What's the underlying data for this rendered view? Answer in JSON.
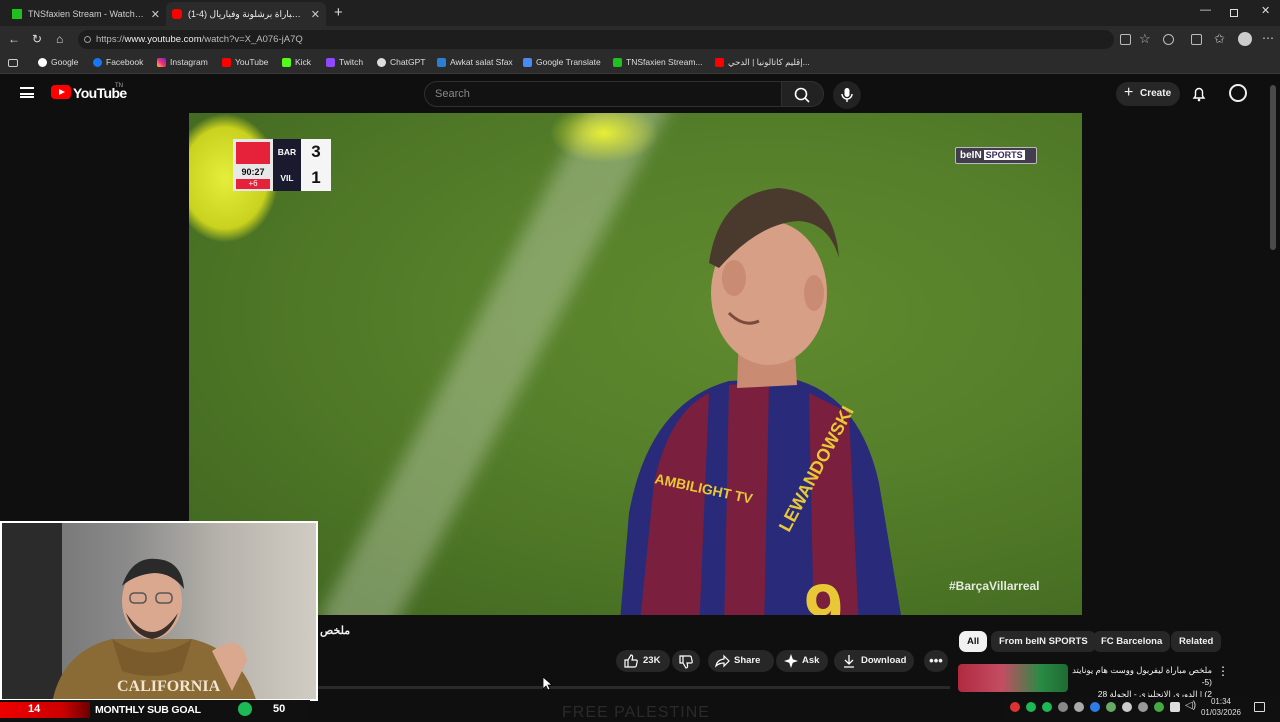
{
  "browser": {
    "tabs": [
      {
        "title": "TNSfaxien Stream - Watch Live on",
        "active": false
      },
      {
        "title": "ملخص مباراة برشلونة وفياريال (4-1)",
        "active": true
      }
    ],
    "url_prefix": "https://",
    "url_domain": "www.youtube.com",
    "url_path": "/watch?v=X_A076-jA7Q",
    "bookmarks": [
      "Google",
      "Facebook",
      "Instagram",
      "YouTube",
      "Kick",
      "Twitch",
      "ChatGPT",
      "Awkat salat Sfax",
      "Google Translate",
      "TNSfaxien Stream...",
      "إقليم كاتالونيا | الدحي..."
    ]
  },
  "youtube": {
    "logo_text": "YouTube",
    "logo_country": "TN",
    "search_placeholder": "Search",
    "create_label": "Create"
  },
  "video": {
    "scoreboard": {
      "home_team": "BAR",
      "away_team": "VIL",
      "home_score": "3",
      "away_score": "1",
      "clock": "90:27",
      "added_time": "+6"
    },
    "broadcaster_a": "beIN",
    "broadcaster_b": "SPORTS",
    "hashtag": "#BarçaVillarreal",
    "jersey_name": "LEWANDOWSKI",
    "sponsor": "AMBILIGHT TV"
  },
  "below_video": {
    "title": "ملخص",
    "like_count": "23K",
    "share_label": "Share",
    "ask_label": "Ask",
    "download_label": "Download",
    "chips": [
      "All",
      "From beIN SPORTS",
      "FC Barcelona",
      "Related"
    ],
    "related_title_line1": "ملخص مباراة ليفربول ووست هام يونايتد (5-",
    "related_title_line2": "2) | الدوري الإنجليزي - الجولة 28"
  },
  "stream_overlay": {
    "sub_count": "14",
    "goal_label": "MONTHLY SUB GOAL",
    "goal_target": "50",
    "background_text": "FREE PALESTINE"
  },
  "taskbar": {
    "time": "01:34",
    "date": "01/03/2026"
  },
  "colors": {
    "yt_red": "#ff0000",
    "laliga_red": "#e6213a",
    "bg": "#0f0f0f",
    "pill": "#272727"
  }
}
